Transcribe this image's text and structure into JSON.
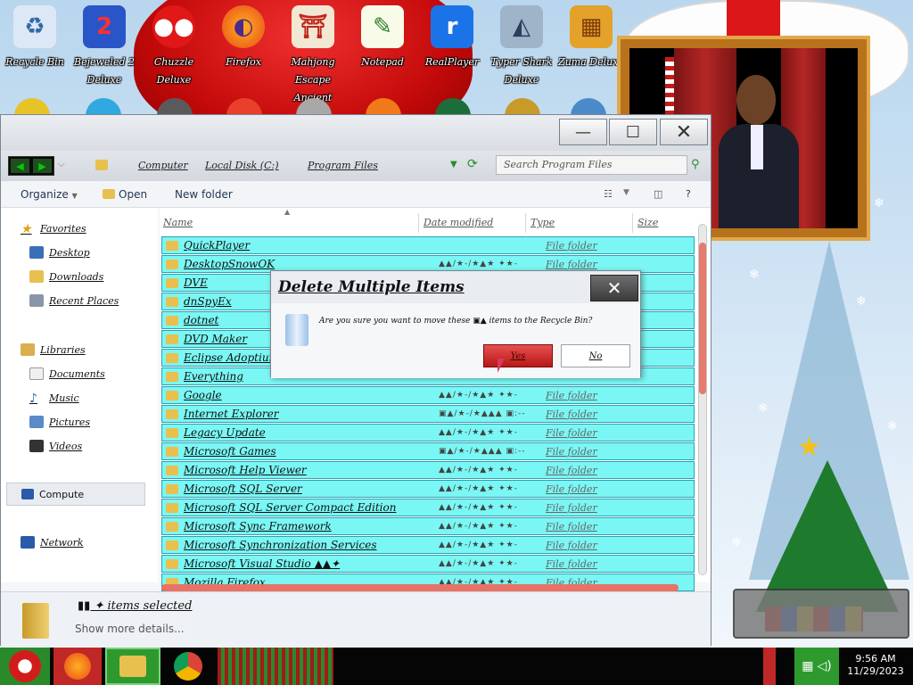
{
  "desktop": {
    "icons": [
      {
        "label": "Recycle Bin",
        "icon": "recycle-bin-icon"
      },
      {
        "label": "Bejeweled 2 Deluxe",
        "icon": "bejeweled-icon"
      },
      {
        "label": "Chuzzle Deluxe",
        "icon": "chuzzle-icon"
      },
      {
        "label": "Firefox",
        "icon": "firefox-icon"
      },
      {
        "label": "Mahjong Escape Ancient Japan",
        "icon": "mahjong-icon"
      },
      {
        "label": "Notepad",
        "icon": "notepad-icon"
      },
      {
        "label": "RealPlayer",
        "icon": "realplayer-icon"
      },
      {
        "label": "Typer Shark Deluxe",
        "icon": "typer-shark-icon"
      },
      {
        "label": "Zuma Deluxe",
        "icon": "zuma-icon"
      }
    ]
  },
  "explorer": {
    "title_buttons": {
      "minimize": "—",
      "maximize": "☐",
      "close": "✕"
    },
    "breadcrumb": [
      "Computer",
      "Local Disk (C:)",
      "Program Files"
    ],
    "search_placeholder": "Search Program Files",
    "toolbar": {
      "organize": "Organize",
      "open": "Open",
      "new_folder": "New folder",
      "help": "?"
    },
    "sidebar": {
      "favorites": "Favorites",
      "desktop": "Desktop",
      "downloads": "Downloads",
      "recent_places": "Recent Places",
      "libraries": "Libraries",
      "documents": "Documents",
      "music": "Music",
      "pictures": "Pictures",
      "videos": "Videos",
      "computer": "Compute",
      "network": "Network"
    },
    "columns": {
      "name": "Name",
      "date_modified": "Date modified",
      "type": "Type",
      "size": "Size"
    },
    "files": [
      {
        "name": "QuickPlayer",
        "date": "",
        "type": "File folder"
      },
      {
        "name": "DesktopSnowOK",
        "date": "▲▲/★-/★▲★ ✦★-",
        "type": "File folder"
      },
      {
        "name": "DVE",
        "date": "▲▲/★-/★▲★ ✦★-",
        "type": "File folder"
      },
      {
        "name": "dnSpyEx",
        "date": "",
        "type": ""
      },
      {
        "name": "dotnet",
        "date": "",
        "type": ""
      },
      {
        "name": "DVD Maker",
        "date": "",
        "type": ""
      },
      {
        "name": "Eclipse Adoptium",
        "date": "",
        "type": ""
      },
      {
        "name": "Everything",
        "date": "",
        "type": ""
      },
      {
        "name": "Google",
        "date": "▲▲/★-/★▲★ ✦★-",
        "type": "File folder"
      },
      {
        "name": "Internet Explorer",
        "date": "▣▲/★-/★▲▲▲ ▣:--",
        "type": "File folder"
      },
      {
        "name": "Legacy Update",
        "date": "▲▲/★-/★▲★ ✦★-",
        "type": "File folder"
      },
      {
        "name": "Microsoft Games",
        "date": "▣▲/★-/★▲▲▲ ▣:--",
        "type": "File folder"
      },
      {
        "name": "Microsoft Help Viewer",
        "date": "▲▲/★-/★▲★ ✦★-",
        "type": "File folder"
      },
      {
        "name": "Microsoft SQL Server",
        "date": "▲▲/★-/★▲★ ✦★-",
        "type": "File folder"
      },
      {
        "name": "Microsoft SQL Server Compact Edition",
        "date": "▲▲/★-/★▲★ ✦★-",
        "type": "File folder"
      },
      {
        "name": "Microsoft Sync Framework",
        "date": "▲▲/★-/★▲★ ✦★-",
        "type": "File folder"
      },
      {
        "name": "Microsoft Synchronization Services",
        "date": "▲▲/★-/★▲★ ✦★-",
        "type": "File folder"
      },
      {
        "name": "Microsoft Visual Studio ▲▲✦",
        "date": "▲▲/★-/★▲★ ✦★-",
        "type": "File folder"
      },
      {
        "name": "Mozilla Firefox",
        "date": "▲▲/★-/★▲★ ✦★-",
        "type": "File folder"
      }
    ],
    "status": {
      "selected": "▮▮ ✦ items selected",
      "more_details": "Show more details..."
    }
  },
  "dialog": {
    "title": "Delete Multiple Items",
    "close": "✕",
    "message": "Are you sure you want to move these ▣▲ items to the Recycle Bin?",
    "yes": "Yes",
    "no": "No"
  },
  "taskbar": {
    "time": "9:56 AM",
    "date": "11/29/2023"
  },
  "colors": {
    "row_highlight": "#7af7f4",
    "yes_button": "#d12a2a",
    "taskbar": "#050505"
  }
}
